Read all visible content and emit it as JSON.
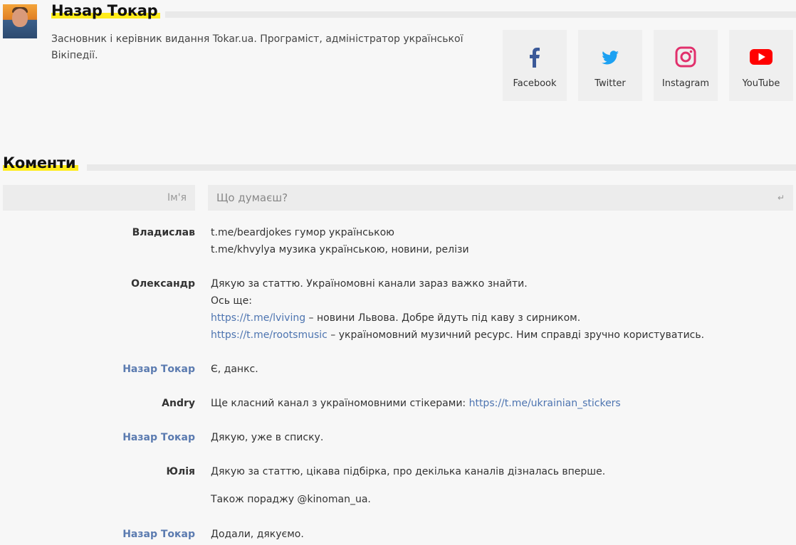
{
  "author": {
    "name": "Назар Токар",
    "bio": "Засновник і керівник видання Tokar.ua. Програміст, адміністратор української Вікіпедії."
  },
  "social": [
    {
      "label": "Facebook",
      "icon": "facebook-icon",
      "color": "#3b5998"
    },
    {
      "label": "Twitter",
      "icon": "twitter-icon",
      "color": "#1da1f2"
    },
    {
      "label": "Instagram",
      "icon": "instagram-icon",
      "color": "#e1306c"
    },
    {
      "label": "YouTube",
      "icon": "youtube-icon",
      "color": "#ff0000"
    }
  ],
  "comments_section": {
    "title": "Коменти",
    "name_placeholder": "Ім'я",
    "comment_placeholder": "Що думаєш?",
    "enter_glyph": "↵"
  },
  "comments": [
    {
      "author": "Владислав",
      "is_author": false,
      "lines": [
        "t.me/beardjokes гумор українською",
        "t.me/khvylya музика українською, новини, релізи"
      ]
    },
    {
      "author": "Олександр",
      "is_author": false,
      "l1": "Дякую за статтю. Україномовні канали зараз важко знайти.",
      "l2": "Ось ще:",
      "link1": "https://t.me/lviving",
      "rest1": " – новини Львова. Добре йдуть під каву з сирником.",
      "link2": "https://t.me/rootsmusic",
      "rest2": " – україномовний музичний ресурс. Ним справді зручно користуватись."
    },
    {
      "author": "Назар Токар",
      "is_author": true,
      "text": "Є, данкс."
    },
    {
      "author": "Andry",
      "is_author": false,
      "pre": "Ще класний канал з україномовними стікерами: ",
      "link": "https://t.me/ukrainian_stickers"
    },
    {
      "author": "Назар Токар",
      "is_author": true,
      "text": "Дякую, уже в списку."
    },
    {
      "author": "Юлія",
      "is_author": false,
      "p1": "Дякую за статтю, цікава підбірка, про декілька каналів дізналась вперше.",
      "p2": "Також пораджу @kinoman_ua."
    },
    {
      "author": "Назар Токар",
      "is_author": true,
      "text": "Додали, дякуємо."
    }
  ]
}
